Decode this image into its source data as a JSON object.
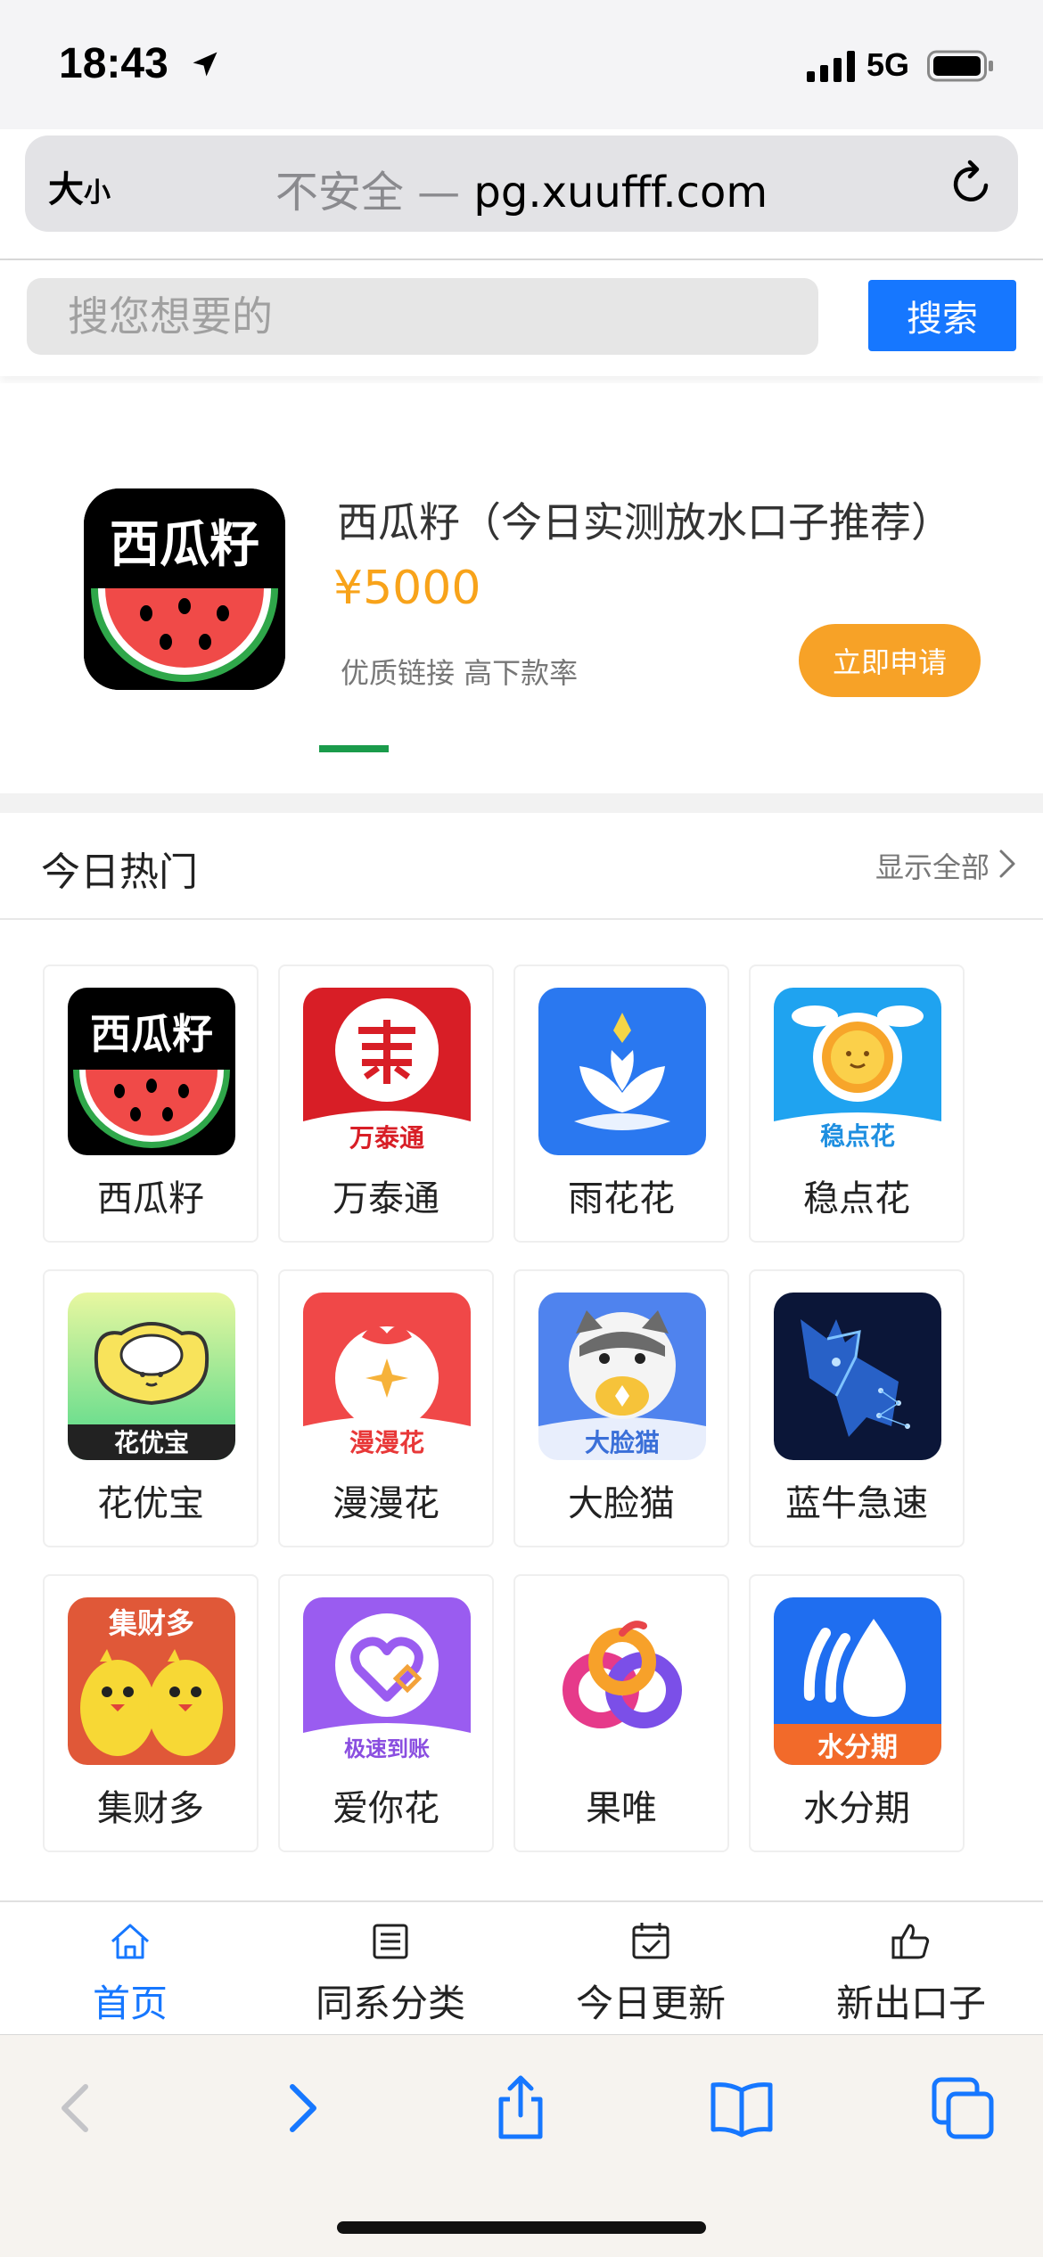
{
  "status": {
    "time": "18:43",
    "network": "5G"
  },
  "urlbar": {
    "text_size_big": "大",
    "text_size_small": "小",
    "insecure": "不安全 — ",
    "domain": "pg.xuufff.com"
  },
  "search": {
    "placeholder": "搜您想要的",
    "button": "搜索"
  },
  "banner": {
    "logo_text": "西瓜籽",
    "title": "西瓜籽（今日实测放水口子推荐）",
    "amount": "¥5000",
    "desc": "优质链接 高下款率",
    "apply": "立即申请"
  },
  "hot": {
    "title": "今日热门",
    "show_all": "显示全部"
  },
  "apps": [
    {
      "label": "西瓜籽",
      "badge": "西瓜籽"
    },
    {
      "label": "万泰通",
      "badge": "万泰通"
    },
    {
      "label": "雨花花",
      "badge": ""
    },
    {
      "label": "稳点花",
      "badge": "稳点花"
    },
    {
      "label": "花优宝",
      "badge": "花优宝"
    },
    {
      "label": "漫漫花",
      "badge": "漫漫花"
    },
    {
      "label": "大脸猫",
      "badge": "大脸猫"
    },
    {
      "label": "蓝牛急速",
      "badge": ""
    },
    {
      "label": "集财多",
      "badge": "集财多"
    },
    {
      "label": "爱你花",
      "badge": "极速到账"
    },
    {
      "label": "果唯",
      "badge": ""
    },
    {
      "label": "水分期",
      "badge": "水分期"
    }
  ],
  "tabs": [
    {
      "label": "首页",
      "icon": "home-icon"
    },
    {
      "label": "同系分类",
      "icon": "list-icon"
    },
    {
      "label": "今日更新",
      "icon": "calendar-check-icon"
    },
    {
      "label": "新出口子",
      "icon": "thumbs-up-icon"
    }
  ],
  "colors": {
    "accent": "#1677ff",
    "apply": "#f7a227",
    "amount": "#f8a31a"
  }
}
